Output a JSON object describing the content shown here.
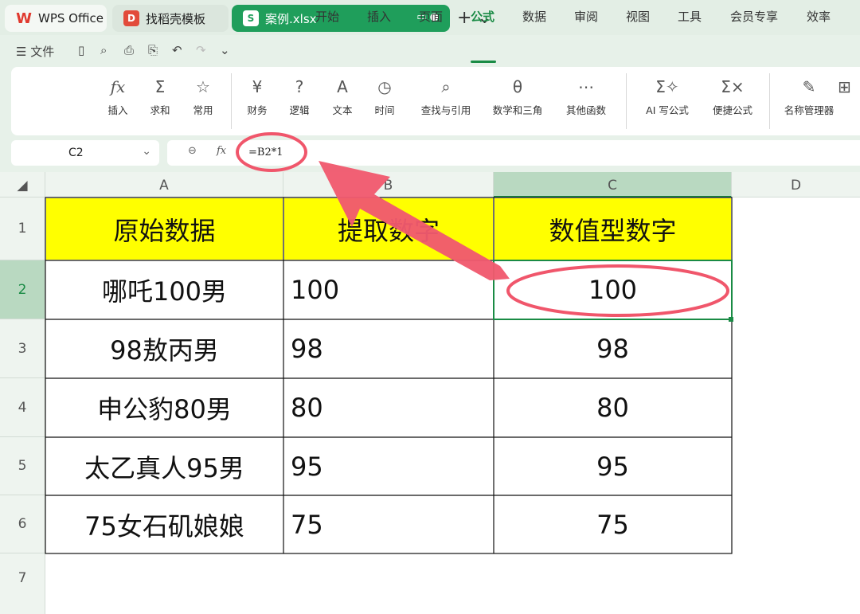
{
  "tabs": {
    "wps": "WPS Office",
    "template": "找稻壳模板",
    "file": "案例.xlsx"
  },
  "menu": {
    "file": "文件",
    "items": [
      "开始",
      "插入",
      "页面",
      "公式",
      "数据",
      "审阅",
      "视图",
      "工具",
      "会员专享",
      "效率"
    ],
    "active": "公式"
  },
  "ribbon": {
    "insert": "插入",
    "sum": "求和",
    "common": "常用",
    "finance": "财务",
    "logic": "逻辑",
    "text": "文本",
    "time": "时间",
    "lookup": "查找与引用",
    "math": "数学和三角",
    "other": "其他函数",
    "ai": "AI 写公式",
    "quick": "便捷公式",
    "names": "名称管理器"
  },
  "formula_bar": {
    "cell_ref": "C2",
    "fx": "fx",
    "formula": "=B2*1"
  },
  "columns": [
    "A",
    "B",
    "C",
    "D"
  ],
  "rows": [
    "1",
    "2",
    "3",
    "4",
    "5",
    "6",
    "7"
  ],
  "table": {
    "headers": [
      "原始数据",
      "提取数字",
      "数值型数字"
    ],
    "data": [
      [
        "哪吒100男",
        "100",
        "100"
      ],
      [
        "98敖丙男",
        "98",
        "98"
      ],
      [
        "申公豹80男",
        "80",
        "80"
      ],
      [
        "太乙真人95男",
        "95",
        "95"
      ],
      [
        "75女石矶娘娘",
        "75",
        "75"
      ]
    ]
  },
  "colors": {
    "accent": "#1a8b45",
    "file_tab": "#1f9e5b",
    "header_fill": "#ffff00",
    "annotation": "#f0566b"
  }
}
